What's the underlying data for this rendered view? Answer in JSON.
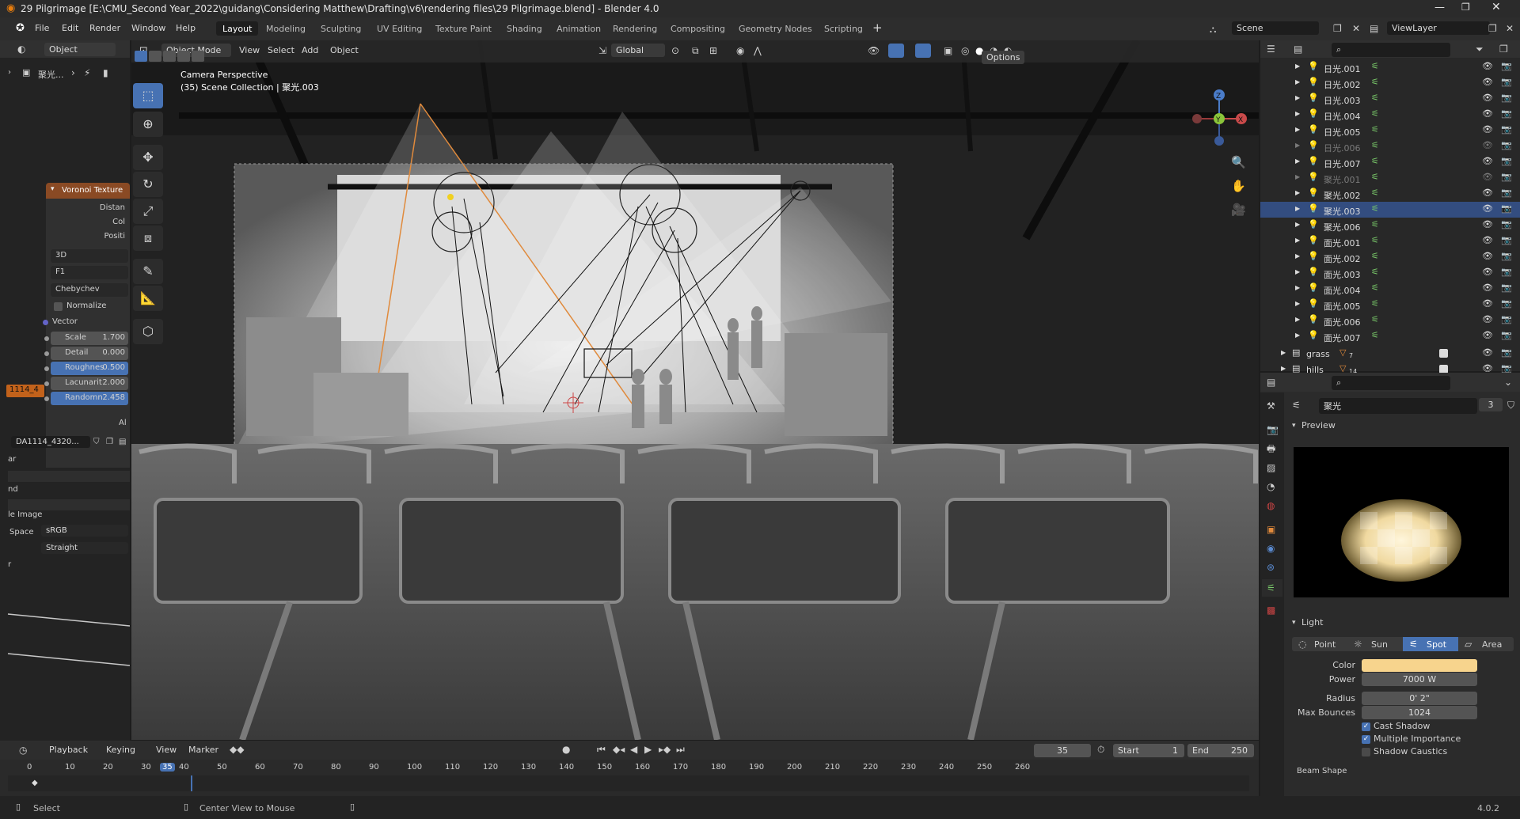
{
  "window": {
    "title": "29 Pilgrimage [E:\\CMU_Second Year_2022\\guidang\\Considering Matthew\\Drafting\\v6\\rendering files\\29 Pilgrimage.blend] - Blender 4.0"
  },
  "menu": [
    "File",
    "Edit",
    "Render",
    "Window",
    "Help"
  ],
  "workspaces": [
    "Layout",
    "Modeling",
    "Sculpting",
    "UV Editing",
    "Texture Paint",
    "Shading",
    "Animation",
    "Rendering",
    "Compositing",
    "Geometry Nodes",
    "Scripting"
  ],
  "active_workspace": "Layout",
  "scene": {
    "label": "Scene",
    "view_layer": "ViewLayer"
  },
  "left_header": {
    "mode": "Object",
    "breadcrumb": "聚光..."
  },
  "node": {
    "title": "Voronoi Texture",
    "outputs": [
      "Distan",
      "Col",
      "Positi"
    ],
    "dims": "3D",
    "feature": "F1",
    "metric": "Chebychev",
    "normalize": "Normalize",
    "vector": "Vector",
    "fields": [
      {
        "label": "Scale",
        "value": "1.700"
      },
      {
        "label": "Detail",
        "value": "0.000"
      },
      {
        "label": "Roughnes",
        "value": "0.500"
      },
      {
        "label": "Lacunarit",
        "value": "2.000"
      },
      {
        "label": "Randomn",
        "value": "2.458"
      }
    ],
    "badge": "1114_4",
    "al": "Al"
  },
  "image_panel": {
    "datablock": "DA1114_4320...",
    "rows": [
      "ar",
      "",
      "nd",
      "le Image"
    ],
    "space_label": "Space",
    "space_value": "sRGB",
    "alpha_value": "Straight",
    "r": "r"
  },
  "viewport_header": {
    "mode": "Object Mode",
    "menus": [
      "View",
      "Select",
      "Add",
      "Object"
    ],
    "orientation": "Global",
    "options": "Options"
  },
  "viewport": {
    "line1": "Camera Perspective",
    "line2": "(35) Scene Collection | 聚光.003"
  },
  "outliner": {
    "rows": [
      {
        "name": "日光.001",
        "dim": false,
        "sel": false
      },
      {
        "name": "日光.002",
        "dim": false,
        "sel": false
      },
      {
        "name": "日光.003",
        "dim": false,
        "sel": false
      },
      {
        "name": "日光.004",
        "dim": false,
        "sel": false
      },
      {
        "name": "日光.005",
        "dim": false,
        "sel": false
      },
      {
        "name": "日光.006",
        "dim": true,
        "sel": false
      },
      {
        "name": "日光.007",
        "dim": false,
        "sel": false
      },
      {
        "name": "聚光.001",
        "dim": true,
        "sel": false
      },
      {
        "name": "聚光.002",
        "dim": false,
        "sel": false
      },
      {
        "name": "聚光.003",
        "dim": false,
        "sel": true
      },
      {
        "name": "聚光.006",
        "dim": false,
        "sel": false
      },
      {
        "name": "面光.001",
        "dim": false,
        "sel": false
      },
      {
        "name": "面光.002",
        "dim": false,
        "sel": false
      },
      {
        "name": "面光.003",
        "dim": false,
        "sel": false
      },
      {
        "name": "面光.004",
        "dim": false,
        "sel": false
      },
      {
        "name": "面光.005",
        "dim": false,
        "sel": false
      },
      {
        "name": "面光.006",
        "dim": false,
        "sel": false
      },
      {
        "name": "面光.007",
        "dim": false,
        "sel": false
      }
    ],
    "collections": [
      {
        "name": "grass",
        "badge": "7"
      },
      {
        "name": "hills",
        "badge": "14"
      }
    ]
  },
  "properties": {
    "data_name": "聚光",
    "users": "3",
    "preview": "Preview",
    "light_section": "Light",
    "light_types": [
      "Point",
      "Sun",
      "Spot",
      "Area"
    ],
    "active_type": "Spot",
    "color_label": "Color",
    "light_color": "#f7d48d",
    "power_label": "Power",
    "power": "7000 W",
    "radius_label": "Radius",
    "radius": "0' 2\"",
    "bounces_label": "Max Bounces",
    "bounces": "1024",
    "cast_shadow": "Cast Shadow",
    "multiple_importance": "Multiple Importance",
    "shadow_caustics": "Shadow Caustics",
    "beam_shape": "Beam Shape"
  },
  "timeline": {
    "menus": [
      "Playback",
      "Keying",
      "View",
      "Marker"
    ],
    "current_frame": "35",
    "start_label": "Start",
    "start": "1",
    "end_label": "End",
    "end": "250",
    "ticks": [
      "0",
      "10",
      "20",
      "30",
      "35",
      "40",
      "50",
      "60",
      "70",
      "80",
      "90",
      "100",
      "110",
      "120",
      "130",
      "140",
      "150",
      "160",
      "170",
      "180",
      "190",
      "200",
      "210",
      "220",
      "230",
      "240",
      "250",
      "260"
    ]
  },
  "status": {
    "select": "Select",
    "center": "Center View to Mouse",
    "version": "4.0.2"
  },
  "colors": {
    "accent": "#4772b3",
    "selection": "#334d80",
    "node_header": "#8a4a24",
    "light_orange": "#e08a3c"
  }
}
